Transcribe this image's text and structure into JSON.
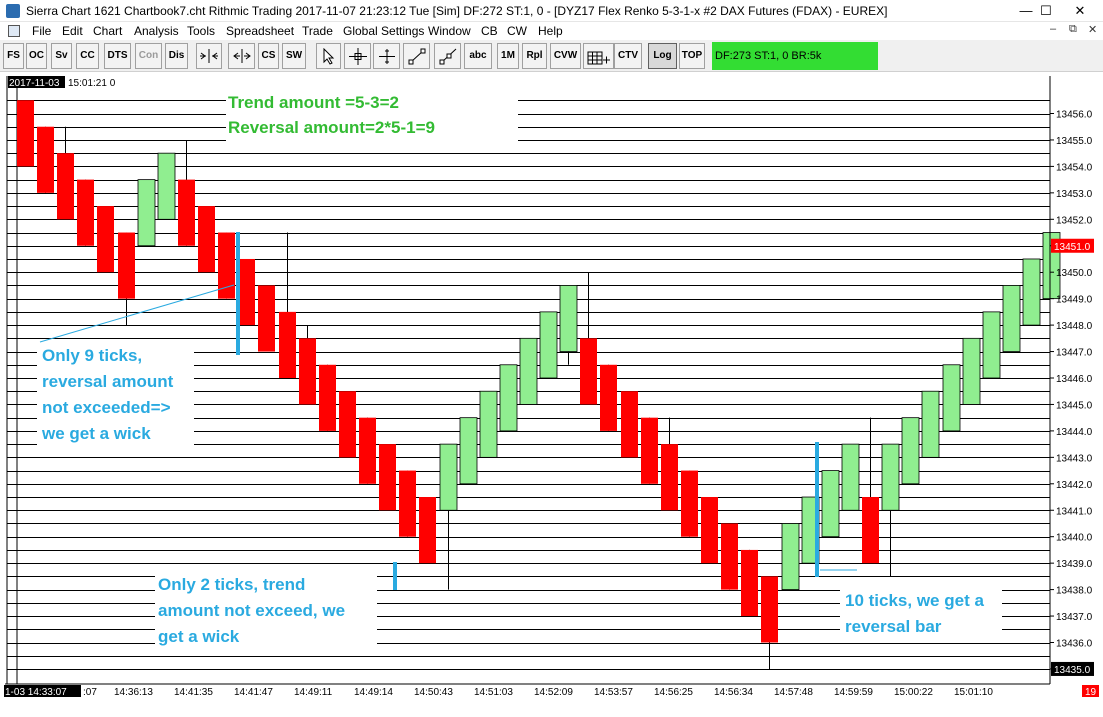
{
  "window": {
    "title": "Sierra Chart 1621 Chartbook7.cht  Rithmic Trading 2017-11-07  21:23:12 Tue [Sim]  DF:272  ST:1, 0 - [DYZ17  Flex Renko 5-3-1-x  #2  DAX Futures (FDAX) - EUREX]",
    "controls": {
      "minimize": "—",
      "maximize": "☐",
      "close": "✕"
    }
  },
  "menu": {
    "items": [
      "File",
      "Edit",
      "Chart",
      "Analysis",
      "Tools",
      "Spreadsheet",
      "Trade",
      "Global Settings",
      "Window",
      "CB",
      "CW",
      "Help"
    ],
    "mdi_controls": [
      "–",
      "⧉",
      "✕"
    ]
  },
  "toolbar": {
    "buttons": [
      {
        "label": "FS"
      },
      {
        "label": "OC"
      },
      {
        "label": "Sv"
      },
      {
        "label": "CC"
      },
      {
        "label": "DTS"
      },
      {
        "label": "Con",
        "disabled": true
      },
      {
        "label": "Dis"
      },
      {
        "icon": "scale-in-icon"
      },
      {
        "icon": "scale-out-icon"
      },
      {
        "label": "CS"
      },
      {
        "label": "SW"
      },
      {
        "icon": "pointer-icon"
      },
      {
        "icon": "crosshair-icon"
      },
      {
        "icon": "cursor-cross-icon"
      },
      {
        "icon": "line-tool-icon"
      },
      {
        "icon": "ray-tool-icon"
      },
      {
        "label": "abc"
      },
      {
        "label": "1M"
      },
      {
        "label": "Rpl"
      },
      {
        "label": "CVW"
      },
      {
        "icon": "tpo-icon",
        "caption": "TPO"
      },
      {
        "label": "CTV"
      },
      {
        "label": "Log",
        "pressed": true
      },
      {
        "label": "TOP"
      }
    ],
    "status_text": "DF:273  ST:1, 0  BR:5k",
    "status_color": "#33dd33"
  },
  "chart": {
    "date_label": "2017-11-03",
    "time_label": "15:01:21 0",
    "annotations": {
      "trend_line1": "Trend amount =5-3=2",
      "trend_line2": "Reversal amount=2*5-1=9",
      "note1": [
        "Only 9 ticks,",
        "reversal amount",
        "not exceeded=>",
        "we get a wick"
      ],
      "note2": [
        "Only 2 ticks, trend",
        "amount not exceed, we",
        "get a wick"
      ],
      "note3": [
        "10 ticks, we get a",
        "reversal bar"
      ]
    },
    "colors": {
      "up": "#90ee90",
      "down": "#ff0000",
      "annotation_green": "#33bb33",
      "annotation_blue": "#2aaae0",
      "last_price_bg": "#ff0000"
    },
    "y_axis": {
      "labels": [
        "13456.0",
        "13455.0",
        "13454.0",
        "13453.0",
        "13452.0",
        "13451.0",
        "13450.0",
        "13449.0",
        "13448.0",
        "13447.0",
        "13446.0",
        "13445.0",
        "13444.0",
        "13443.0",
        "13442.0",
        "13441.0",
        "13440.0",
        "13439.0",
        "13438.0",
        "13437.0",
        "13436.0",
        "13435.0"
      ],
      "last_price": "13451.0"
    },
    "x_axis": {
      "first_label": "1-03  14:33:07",
      "labels": [
        ":07",
        "14:36:13",
        "14:41:35",
        "14:41:47",
        "14:49:11",
        "14:49:14",
        "14:50:43",
        "14:51:03",
        "14:52:09",
        "14:53:57",
        "14:56:25",
        "14:56:34",
        "14:57:48",
        "14:59:59",
        "15:00:22",
        "15:01:10"
      ],
      "corner_badge": "19"
    }
  },
  "chart_data": {
    "type": "candlestick",
    "instrument": "DYZ17  Flex Renko 5-3-1-x  #2  DAX Futures (FDAX) - EUREX",
    "y_range": [
      13435,
      13456.5
    ],
    "bars": [
      {
        "dir": "down",
        "open": 13456.5,
        "close": 13454.0,
        "high": 13456.5,
        "low": 13454.0
      },
      {
        "dir": "down",
        "open": 13455.5,
        "close": 13453.0,
        "high": 13455.5,
        "low": 13453.0
      },
      {
        "dir": "down",
        "open": 13454.5,
        "close": 13452.0,
        "high": 13455.5,
        "low": 13452.0
      },
      {
        "dir": "down",
        "open": 13453.5,
        "close": 13451.0,
        "high": 13453.5,
        "low": 13451.0
      },
      {
        "dir": "down",
        "open": 13452.5,
        "close": 13450.0,
        "high": 13452.5,
        "low": 13450.0
      },
      {
        "dir": "down",
        "open": 13451.5,
        "close": 13449.0,
        "high": 13451.5,
        "low": 13448.0
      },
      {
        "dir": "up",
        "open": 13451.0,
        "close": 13453.5,
        "high": 13453.5,
        "low": 13451.0
      },
      {
        "dir": "up",
        "open": 13452.0,
        "close": 13454.5,
        "high": 13454.5,
        "low": 13452.0
      },
      {
        "dir": "down",
        "open": 13453.5,
        "close": 13451.0,
        "high": 13455.0,
        "low": 13451.0
      },
      {
        "dir": "down",
        "open": 13452.5,
        "close": 13450.0,
        "high": 13452.5,
        "low": 13450.0
      },
      {
        "dir": "down",
        "open": 13451.5,
        "close": 13449.0,
        "high": 13451.5,
        "low": 13449.0
      },
      {
        "dir": "down",
        "open": 13450.5,
        "close": 13448.0,
        "high": 13450.5,
        "low": 13448.0
      },
      {
        "dir": "down",
        "open": 13449.5,
        "close": 13447.0,
        "high": 13449.5,
        "low": 13447.0
      },
      {
        "dir": "down",
        "open": 13448.5,
        "close": 13446.0,
        "high": 13451.5,
        "low": 13446.0
      },
      {
        "dir": "down",
        "open": 13447.5,
        "close": 13445.0,
        "high": 13448.0,
        "low": 13445.0
      },
      {
        "dir": "down",
        "open": 13446.5,
        "close": 13444.0,
        "high": 13446.5,
        "low": 13444.0
      },
      {
        "dir": "down",
        "open": 13445.5,
        "close": 13443.0,
        "high": 13445.5,
        "low": 13443.0
      },
      {
        "dir": "down",
        "open": 13444.5,
        "close": 13442.0,
        "high": 13444.5,
        "low": 13442.0
      },
      {
        "dir": "down",
        "open": 13443.5,
        "close": 13441.0,
        "high": 13443.5,
        "low": 13441.0
      },
      {
        "dir": "down",
        "open": 13442.5,
        "close": 13440.0,
        "high": 13442.5,
        "low": 13440.0
      },
      {
        "dir": "down",
        "open": 13441.5,
        "close": 13439.0,
        "high": 13441.5,
        "low": 13439.0
      },
      {
        "dir": "up",
        "open": 13441.0,
        "close": 13443.5,
        "high": 13443.5,
        "low": 13438.0
      },
      {
        "dir": "up",
        "open": 13442.0,
        "close": 13444.5,
        "high": 13444.5,
        "low": 13442.0
      },
      {
        "dir": "up",
        "open": 13443.0,
        "close": 13445.5,
        "high": 13445.5,
        "low": 13443.0
      },
      {
        "dir": "up",
        "open": 13444.0,
        "close": 13446.5,
        "high": 13446.5,
        "low": 13444.0
      },
      {
        "dir": "up",
        "open": 13445.0,
        "close": 13447.5,
        "high": 13447.5,
        "low": 13445.0
      },
      {
        "dir": "up",
        "open": 13446.0,
        "close": 13448.5,
        "high": 13448.5,
        "low": 13446.0
      },
      {
        "dir": "up",
        "open": 13447.0,
        "close": 13449.5,
        "high": 13449.5,
        "low": 13446.5
      },
      {
        "dir": "down",
        "open": 13447.5,
        "close": 13445.0,
        "high": 13450.0,
        "low": 13445.0
      },
      {
        "dir": "down",
        "open": 13446.5,
        "close": 13444.0,
        "high": 13446.5,
        "low": 13444.0
      },
      {
        "dir": "down",
        "open": 13445.5,
        "close": 13443.0,
        "high": 13445.5,
        "low": 13443.0
      },
      {
        "dir": "down",
        "open": 13444.5,
        "close": 13442.0,
        "high": 13444.5,
        "low": 13442.0
      },
      {
        "dir": "down",
        "open": 13443.5,
        "close": 13441.0,
        "high": 13444.5,
        "low": 13441.0
      },
      {
        "dir": "down",
        "open": 13442.5,
        "close": 13440.0,
        "high": 13442.5,
        "low": 13440.0
      },
      {
        "dir": "down",
        "open": 13441.5,
        "close": 13439.0,
        "high": 13441.5,
        "low": 13439.0
      },
      {
        "dir": "down",
        "open": 13440.5,
        "close": 13438.0,
        "high": 13440.5,
        "low": 13438.0
      },
      {
        "dir": "down",
        "open": 13439.5,
        "close": 13437.0,
        "high": 13439.5,
        "low": 13437.0
      },
      {
        "dir": "down",
        "open": 13438.5,
        "close": 13436.0,
        "high": 13438.5,
        "low": 13435.0
      },
      {
        "dir": "up",
        "open": 13438.0,
        "close": 13440.5,
        "high": 13440.5,
        "low": 13438.0
      },
      {
        "dir": "up",
        "open": 13439.0,
        "close": 13441.5,
        "high": 13441.5,
        "low": 13439.0
      },
      {
        "dir": "up",
        "open": 13440.0,
        "close": 13442.5,
        "high": 13442.5,
        "low": 13440.0
      },
      {
        "dir": "up",
        "open": 13441.0,
        "close": 13443.5,
        "high": 13443.5,
        "low": 13441.0
      },
      {
        "dir": "down",
        "open": 13441.5,
        "close": 13439.0,
        "high": 13444.5,
        "low": 13439.0
      },
      {
        "dir": "up",
        "open": 13441.0,
        "close": 13443.5,
        "high": 13443.5,
        "low": 13438.5
      },
      {
        "dir": "up",
        "open": 13442.0,
        "close": 13444.5,
        "high": 13444.5,
        "low": 13442.0
      },
      {
        "dir": "up",
        "open": 13443.0,
        "close": 13445.5,
        "high": 13445.5,
        "low": 13443.0
      },
      {
        "dir": "up",
        "open": 13444.0,
        "close": 13446.5,
        "high": 13446.5,
        "low": 13444.0
      },
      {
        "dir": "up",
        "open": 13445.0,
        "close": 13447.5,
        "high": 13447.5,
        "low": 13445.0
      },
      {
        "dir": "up",
        "open": 13446.0,
        "close": 13448.5,
        "high": 13448.5,
        "low": 13446.0
      },
      {
        "dir": "up",
        "open": 13447.0,
        "close": 13449.5,
        "high": 13449.5,
        "low": 13447.0
      },
      {
        "dir": "up",
        "open": 13448.0,
        "close": 13450.5,
        "high": 13450.5,
        "low": 13448.0
      },
      {
        "dir": "up",
        "open": 13449.0,
        "close": 13451.5,
        "high": 13451.5,
        "low": 13449.0
      }
    ]
  }
}
